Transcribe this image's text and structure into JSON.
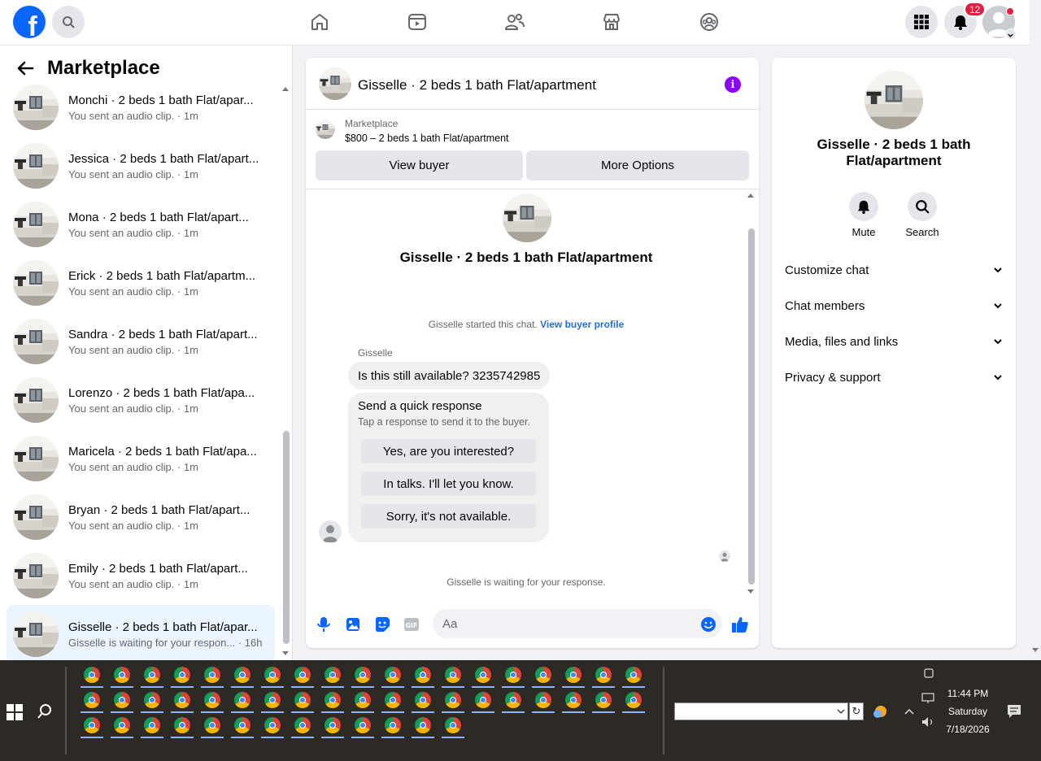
{
  "topbar": {
    "logo_letter": "f",
    "nav": [
      "home-icon",
      "watch-icon",
      "friends-icon",
      "marketplace-icon",
      "groups-icon"
    ],
    "notifications_count": "12"
  },
  "left": {
    "title": "Marketplace",
    "conversations": [
      {
        "name": "Monchi · 2 beds 1 bath Flat/apar...",
        "sub": "You sent an audio clip. · 1m"
      },
      {
        "name": "Jessica · 2 beds 1 bath Flat/apart...",
        "sub": "You sent an audio clip. · 1m"
      },
      {
        "name": "Mona · 2 beds 1 bath Flat/apart...",
        "sub": "You sent an audio clip. · 1m"
      },
      {
        "name": "Erick · 2 beds 1 bath Flat/apartm...",
        "sub": "You sent an audio clip. · 1m"
      },
      {
        "name": "Sandra · 2 beds 1 bath Flat/apart...",
        "sub": "You sent an audio clip. · 1m"
      },
      {
        "name": "Lorenzo · 2 beds 1 bath Flat/apa...",
        "sub": "You sent an audio clip. · 1m"
      },
      {
        "name": "Maricela · 2 beds 1 bath Flat/apa...",
        "sub": "You sent an audio clip. · 1m"
      },
      {
        "name": "Bryan · 2 beds 1 bath Flat/apart...",
        "sub": "You sent an audio clip. · 1m"
      },
      {
        "name": "Emily · 2 beds 1 bath Flat/apart...",
        "sub": "You sent an audio clip. · 1m"
      },
      {
        "name": "Gisselle · 2 beds 1 bath Flat/apar...",
        "sub": "Gisselle is waiting for your respon... · 16h"
      }
    ]
  },
  "chat": {
    "header_title": "Gisselle · 2 beds 1 bath Flat/apartment",
    "marketplace_label": "Marketplace",
    "listing_price": "$800 – 2 beds 1 bath Flat/apartment",
    "view_buyer": "View buyer",
    "more_options": "More Options",
    "center_title": "Gisselle · 2 beds 1 bath Flat/apartment",
    "started_text": "Gisselle started this chat.",
    "view_profile": "View buyer profile",
    "sender_name": "Gisselle",
    "message": "Is this still available? 3235742985",
    "quick_title": "Send a quick response",
    "quick_sub": "Tap a response to send it to the buyer.",
    "quick_responses": [
      "Yes, are you interested?",
      "In talks. I'll let you know.",
      "Sorry, it's not available."
    ],
    "waiting": "Gisselle is waiting for your response.",
    "input_placeholder": "Aa"
  },
  "info": {
    "name": "Gisselle · 2 beds 1 bath Flat/apartment",
    "mute": "Mute",
    "search": "Search",
    "rows": [
      "Customize chat",
      "Chat members",
      "Media, files and links",
      "Privacy & support"
    ]
  },
  "taskbar": {
    "time": "11:44 PM",
    "day": "Saturday",
    "date": "7/18/2026"
  },
  "colors": {
    "brand": "#0866ff",
    "accent": "#8b00ff",
    "link": "#216fdb"
  }
}
